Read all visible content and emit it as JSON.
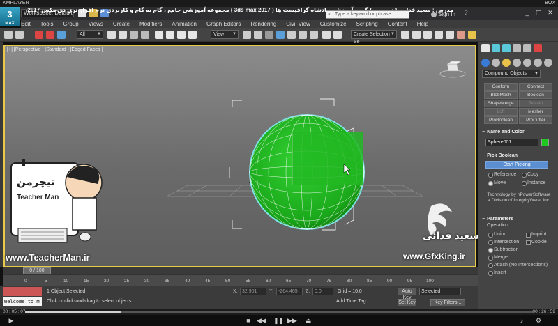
{
  "player": {
    "name": "KMPLAYER",
    "right_label": "BOX",
    "time_elapsed": "00 : 05 : 07",
    "time_total": "00 : 26 : 59",
    "progress": 0.19
  },
  "title": {
    "persian": "مجموعه آموزشی جامع ، گام به گام و کاربردی نرم افزار تری دی مکس 2017 ( 3ds max 2017 ) مدرس : سعید فدایی ( تیچرمن ) گروه آموزشی پادشاه گرافیست ها",
    "app_logo": "3",
    "app_logo_sub": "MAX",
    "workspace": "Workspace: Default",
    "search_placeholder": "Type a keyword or phrase",
    "sign_in": "Sign In",
    "help": "?",
    "minimize": "_",
    "restore": "▢",
    "close": "✕"
  },
  "menu": [
    "Edit",
    "Tools",
    "Group",
    "Views",
    "Create",
    "Modifiers",
    "Animation",
    "Graph Editors",
    "Rendering",
    "Civil View",
    "Customize",
    "Scripting",
    "Content",
    "Help"
  ],
  "toolbar": {
    "filter": "All",
    "ref_coord": "View",
    "selection_set": "Create Selection Se"
  },
  "viewport": {
    "label": "[+] [Perspective ] [Standard ] [Edged Faces ]"
  },
  "command_panel": {
    "category": "Compound Objects",
    "object_buttons": [
      "Conform",
      "Connect",
      "BlobMesh",
      "Boolean",
      "ShapeMerge",
      "Terrain",
      "Loft",
      "Mesher",
      "ProBoolean",
      "ProCutter"
    ],
    "name_and_color": {
      "heading": "Name and Color",
      "object_name": "Sphere001",
      "color": "#1ec81e"
    },
    "pick_boolean": {
      "heading": "Pick Boolean",
      "start_picking": "Start Picking",
      "options": [
        "Reference",
        "Copy",
        "Move",
        "Instance"
      ],
      "selected": "Move",
      "tech_note": "Technology by nPowerSoftware a Division of IntegrityWare, Inc."
    },
    "parameters": {
      "heading": "Parameters",
      "operation_label": "Operation:",
      "operations": [
        "Union",
        "Intersection",
        "Subtraction",
        "Merge",
        "Attach (No Intersections)",
        "Insert"
      ],
      "selected": "Subtraction",
      "checks": [
        "Imprint",
        "Cookie"
      ]
    }
  },
  "timeline": {
    "frame": "0 / 100",
    "ticks": [
      "0",
      "5",
      "10",
      "15",
      "20",
      "25",
      "30",
      "35",
      "40",
      "45",
      "50",
      "55",
      "60",
      "65",
      "70",
      "75",
      "80",
      "85",
      "90",
      "95",
      "100"
    ]
  },
  "status": {
    "listener_text": "Welcome to M",
    "selection": "1 Object Selected",
    "prompt": "Click or click-and-drag to select objects",
    "x_label": "X:",
    "x": "32.901",
    "y_label": "Y:",
    "y": "-264.465",
    "z_label": "Z:",
    "z": "0.0",
    "grid": "Grid = 10.0",
    "add_time_tag": "Add Time Tag",
    "auto_key": "Auto Key",
    "set_key": "Set Key",
    "key_mode": "Selected",
    "key_filters": "Key Filters..."
  },
  "watermarks": {
    "teacherman_logo_text": "تیچرمن",
    "teacherman_en": "Teacher Man",
    "teacherman_url": "www.TeacherMan.ir",
    "gfxking_name": "سعید فدائی",
    "gfxking_url": "www.GfxKing.ir"
  }
}
